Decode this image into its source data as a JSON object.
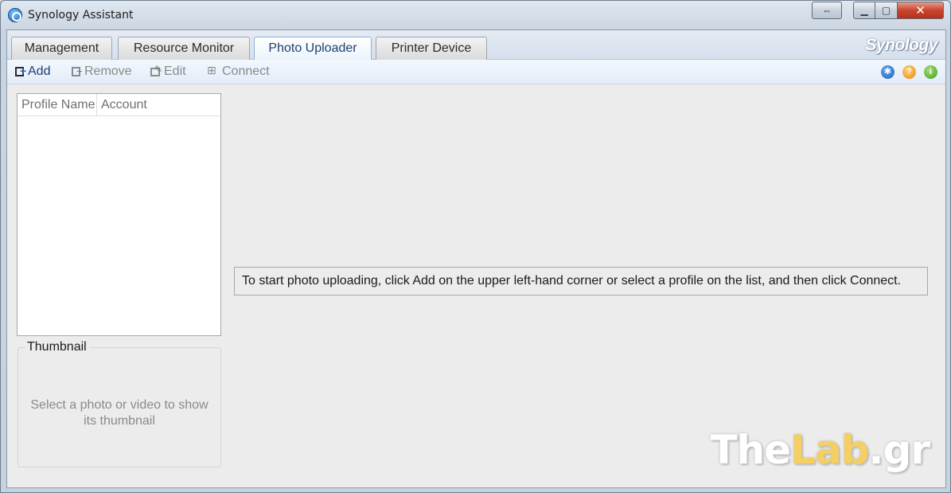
{
  "window": {
    "title": "Synology Assistant"
  },
  "tabs": [
    {
      "label": "Management",
      "active": false
    },
    {
      "label": "Resource Monitor",
      "active": false
    },
    {
      "label": "Photo Uploader",
      "active": true
    },
    {
      "label": "Printer Device",
      "active": false
    }
  ],
  "brand": "Synology",
  "toolbar": {
    "add_label": "Add",
    "remove_label": "Remove",
    "edit_label": "Edit",
    "connect_label": "Connect",
    "icons": [
      "gear-icon",
      "help-icon",
      "info-icon"
    ]
  },
  "profile_list": {
    "columns": [
      "Profile Name",
      "Account"
    ],
    "rows": []
  },
  "thumbnail": {
    "title": "Thumbnail",
    "placeholder": "Select a photo or video to show its thumbnail"
  },
  "message": "To start photo uploading, click Add on the upper left-hand corner or select a profile on the list, and then click Connect.",
  "watermark": {
    "part1": "The",
    "part2": "Lab",
    "part3": ".gr"
  },
  "colors": {
    "active_tab_text": "#1d3f72",
    "disabled_text": "#8a8a8a",
    "close_button": "#c8452f"
  }
}
